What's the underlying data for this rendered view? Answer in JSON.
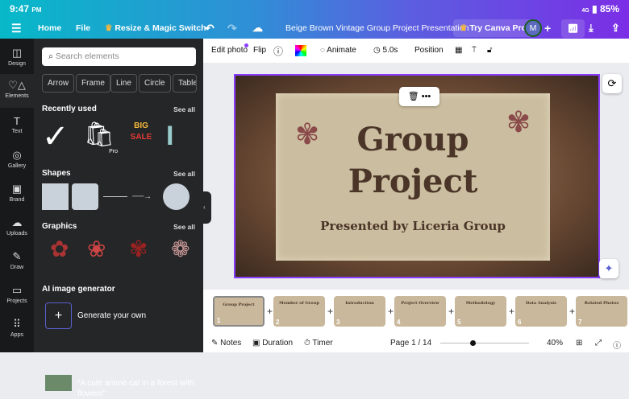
{
  "status": {
    "time": "9:47",
    "ampm": "PM",
    "network": "4G",
    "battery": "85%"
  },
  "nav": {
    "home": "Home",
    "file": "File",
    "resize": "Resize & Magic Switch",
    "title": "Beige Brown Vintage Group Project Presentation",
    "try_pro": "Try Canva Pro",
    "avatar": "M"
  },
  "rail": [
    "Design",
    "Elements",
    "Text",
    "Gallery",
    "Brand",
    "Uploads",
    "Draw",
    "Projects",
    "Apps"
  ],
  "panel": {
    "search_placeholder": "Search elements",
    "chips": [
      "Arrow",
      "Frame",
      "Line",
      "Circle",
      "Table"
    ],
    "recent": "Recently used",
    "shapes": "Shapes",
    "graphics": "Graphics",
    "see_all": "See all",
    "pro": "Pro",
    "big": "BIG",
    "sale": "SALE",
    "ai": "AI image generator",
    "generate": "Generate your own",
    "prompt": "“A cute anime cat in a forest with flowers”"
  },
  "toolbar": {
    "edit_photo": "Edit photo",
    "flip": "Flip",
    "animate": "Animate",
    "duration": "5.0s",
    "position": "Position"
  },
  "slide": {
    "line1": "Group",
    "line2": "Project",
    "subtitle": "Presented by Liceria Group"
  },
  "thumbnails": [
    {
      "n": "1",
      "title": "Group Project"
    },
    {
      "n": "2",
      "title": "Member of Group"
    },
    {
      "n": "3",
      "title": "Introduction"
    },
    {
      "n": "4",
      "title": "Project Overview"
    },
    {
      "n": "5",
      "title": "Methodology"
    },
    {
      "n": "6",
      "title": "Data Analysis"
    },
    {
      "n": "7",
      "title": "Related Photos"
    }
  ],
  "bottom": {
    "notes": "Notes",
    "duration": "Duration",
    "timer": "Timer",
    "page": "Page 1 / 14",
    "zoom": "40%",
    "zoom_value": 40
  },
  "colors": {
    "accent": "#8b3dff",
    "panel": "#252627"
  }
}
